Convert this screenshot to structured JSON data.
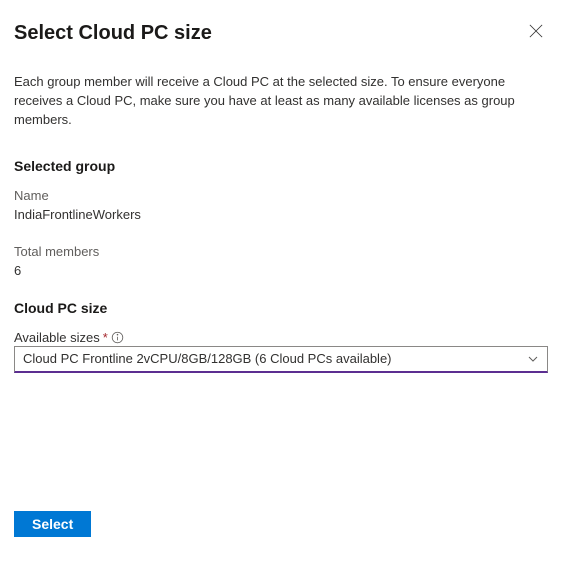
{
  "header": {
    "title": "Select Cloud PC size"
  },
  "description": "Each group member will receive a Cloud PC at the selected size. To ensure everyone receives a Cloud PC, make sure you have at least as many available licenses as group members.",
  "selected_group": {
    "heading": "Selected group",
    "name_label": "Name",
    "name_value": "IndiaFrontlineWorkers",
    "total_label": "Total members",
    "total_value": "6"
  },
  "cloud_pc_size": {
    "heading": "Cloud PC size",
    "label": "Available sizes",
    "required_marker": "*",
    "selected": "Cloud PC Frontline 2vCPU/8GB/128GB (6 Cloud PCs available)"
  },
  "footer": {
    "select_label": "Select"
  }
}
